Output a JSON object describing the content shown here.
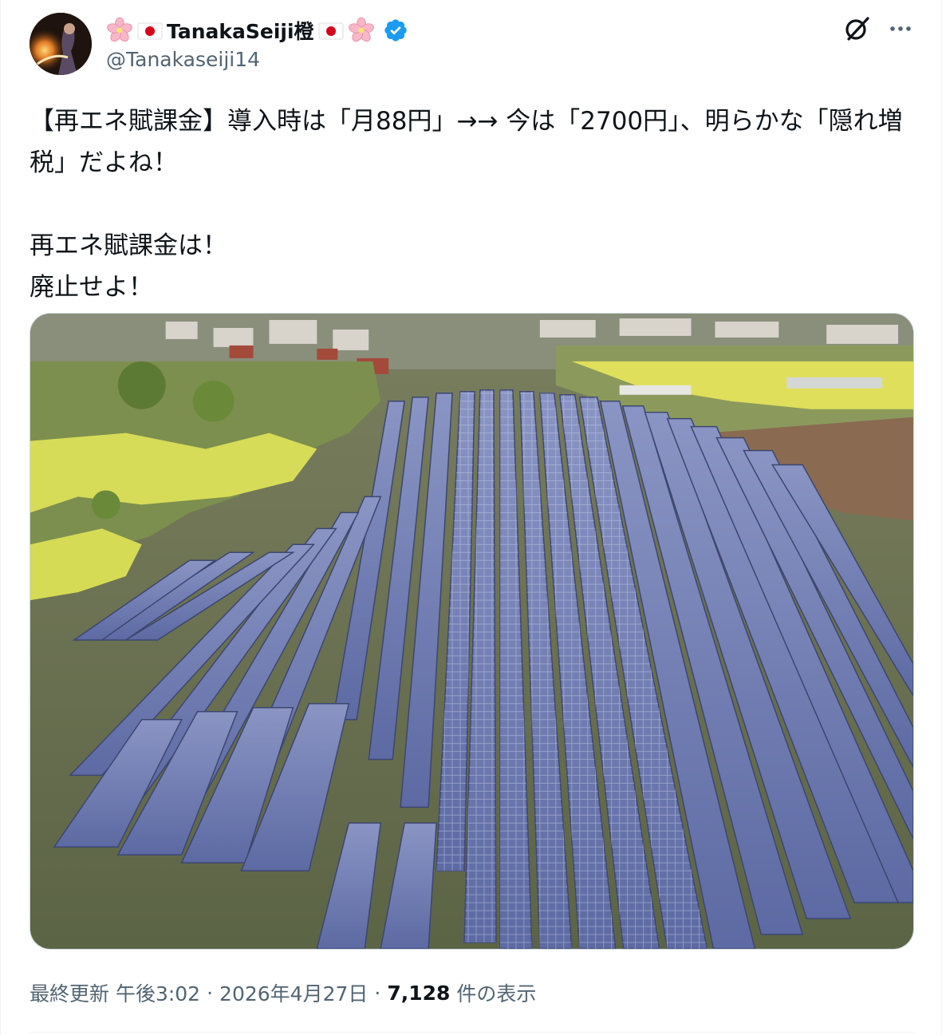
{
  "user": {
    "display_name": "TanakaSeiji橙",
    "handle": "@Tanakaseiji14",
    "verified": true
  },
  "icons": {
    "grok": "grok-icon",
    "more": "more-icon",
    "verified": "verified-badge-icon",
    "decorations": [
      "sakura-icon",
      "japan-flag-icon"
    ]
  },
  "tweet": {
    "text": "【再エネ賦課金】導入時は「月88円」→→ 今は「2700円」、明らかな「隠れ増税」だよね！\n\n再エネ賦課金は！\n廃止せよ！",
    "time": "最終更新 午後3:02",
    "date": "2026年4月27日",
    "views_count": "7,128",
    "views_label": "件の表示"
  },
  "colors": {
    "text": "#0f1419",
    "secondary": "#536471",
    "verified": "#1d9bf0"
  }
}
